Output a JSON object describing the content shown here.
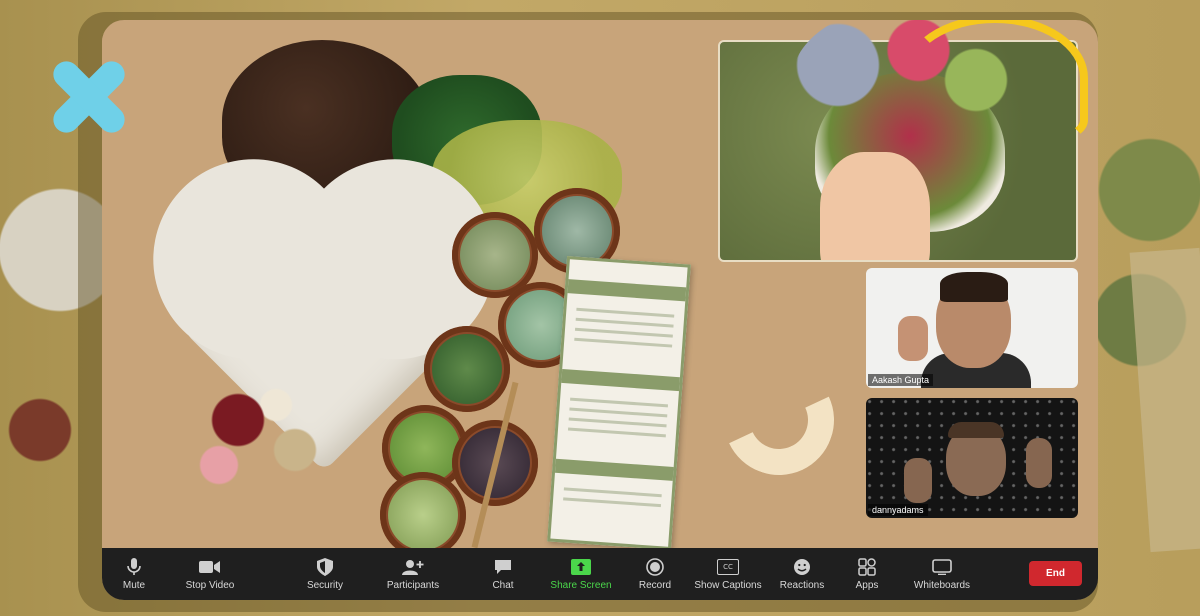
{
  "participants": [
    {
      "name": "Aakash Gupta"
    },
    {
      "name": "dannyadams"
    }
  ],
  "toolbar": {
    "mute": "Mute",
    "stop_video": "Stop Video",
    "security": "Security",
    "participants": "Participants",
    "chat": "Chat",
    "share_screen": "Share Screen",
    "record": "Record",
    "show_captions": "Show Captions",
    "reactions": "Reactions",
    "apps": "Apps",
    "whiteboards": "Whiteboards",
    "end": "End",
    "captions_icon_text": "CC"
  },
  "colors": {
    "toolbar_bg": "#1f1f1f",
    "share_screen": "#4bd64b",
    "end_button": "#d0282e",
    "accent_x": "#6fd0e8",
    "frame_backdrop": "#b9a05c"
  },
  "icons": [
    "microphone-icon",
    "video-camera-icon",
    "shield-icon",
    "participants-icon",
    "chat-bubble-icon",
    "share-screen-icon",
    "record-icon",
    "captions-icon",
    "reactions-icon",
    "apps-icon",
    "whiteboard-icon"
  ]
}
